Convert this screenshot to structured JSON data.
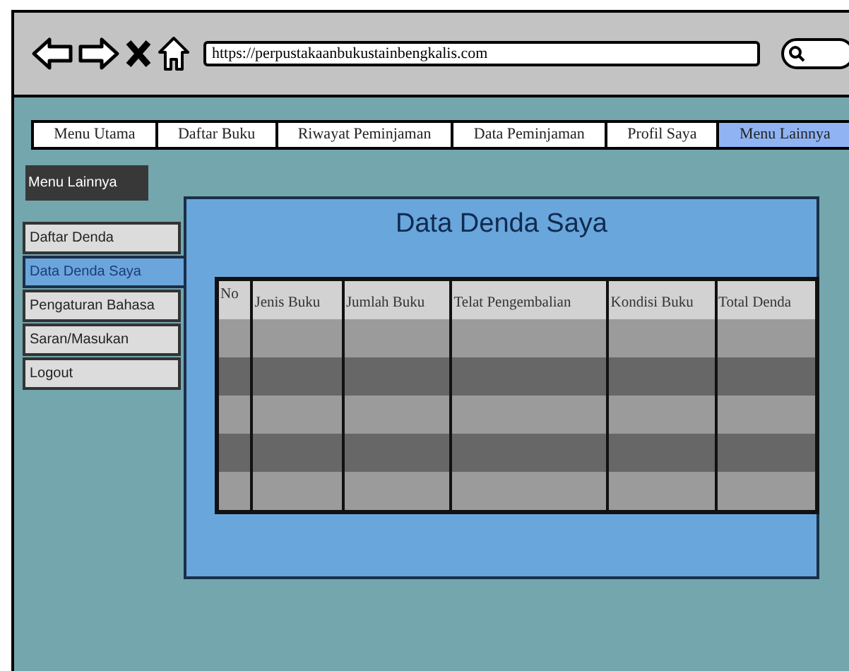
{
  "browser": {
    "url": "https://perpustakaanbukustainbengkalis.com"
  },
  "nav_tabs": [
    {
      "label": "Menu Utama",
      "selected": false
    },
    {
      "label": "Daftar Buku",
      "selected": false
    },
    {
      "label": "Riwayat Peminjaman",
      "selected": false
    },
    {
      "label": "Data Peminjaman",
      "selected": false
    },
    {
      "label": "Profil Saya",
      "selected": false
    },
    {
      "label": "Menu Lainnya",
      "selected": true
    }
  ],
  "sidebar": {
    "title": "Menu Lainnya",
    "items": [
      {
        "label": "Daftar Denda",
        "selected": false
      },
      {
        "label": "Data Denda Saya",
        "selected": true
      },
      {
        "label": "Pengaturan Bahasa",
        "selected": false
      },
      {
        "label": "Saran/Masukan",
        "selected": false
      },
      {
        "label": "Logout",
        "selected": false
      }
    ]
  },
  "panel": {
    "title": "Data Denda Saya"
  },
  "table": {
    "columns": [
      "No",
      "Jenis Buku",
      "Jumlah Buku",
      "Telat Pengembalian",
      "Kondisi Buku",
      "Total Denda"
    ]
  }
}
